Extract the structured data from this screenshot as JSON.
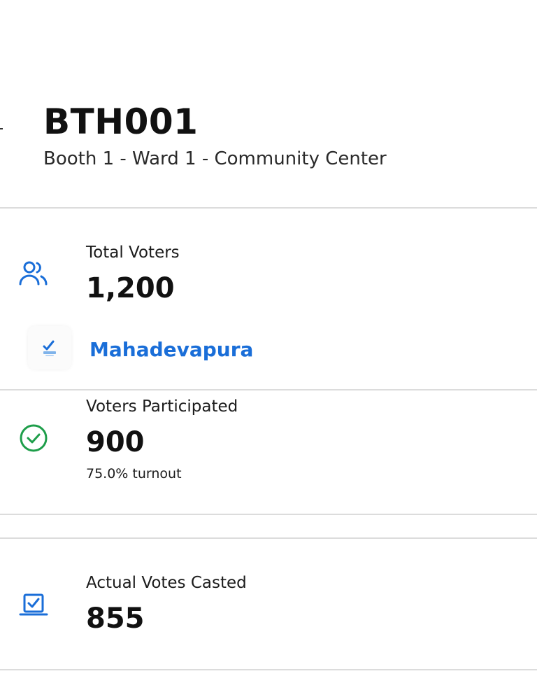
{
  "booth": {
    "code": "BTH001",
    "description": "Booth 1 - Ward 1 - Community Center"
  },
  "stats": {
    "total_voters": {
      "label": "Total Voters",
      "value": "1,200",
      "icon": "users-icon",
      "color": "#1a6ed8"
    },
    "constituency": {
      "name": "Mahadevapura",
      "icon": "ballot-logo-icon",
      "color": "#1a6ed8"
    },
    "voters_participated": {
      "label": "Voters Participated",
      "value": "900",
      "turnout": "75.0% turnout",
      "icon": "check-circle-icon",
      "color": "#1e9e4a"
    },
    "actual_votes": {
      "label": "Actual Votes Casted",
      "value": "855",
      "icon": "ballot-box-icon",
      "color": "#1a6ed8"
    }
  }
}
